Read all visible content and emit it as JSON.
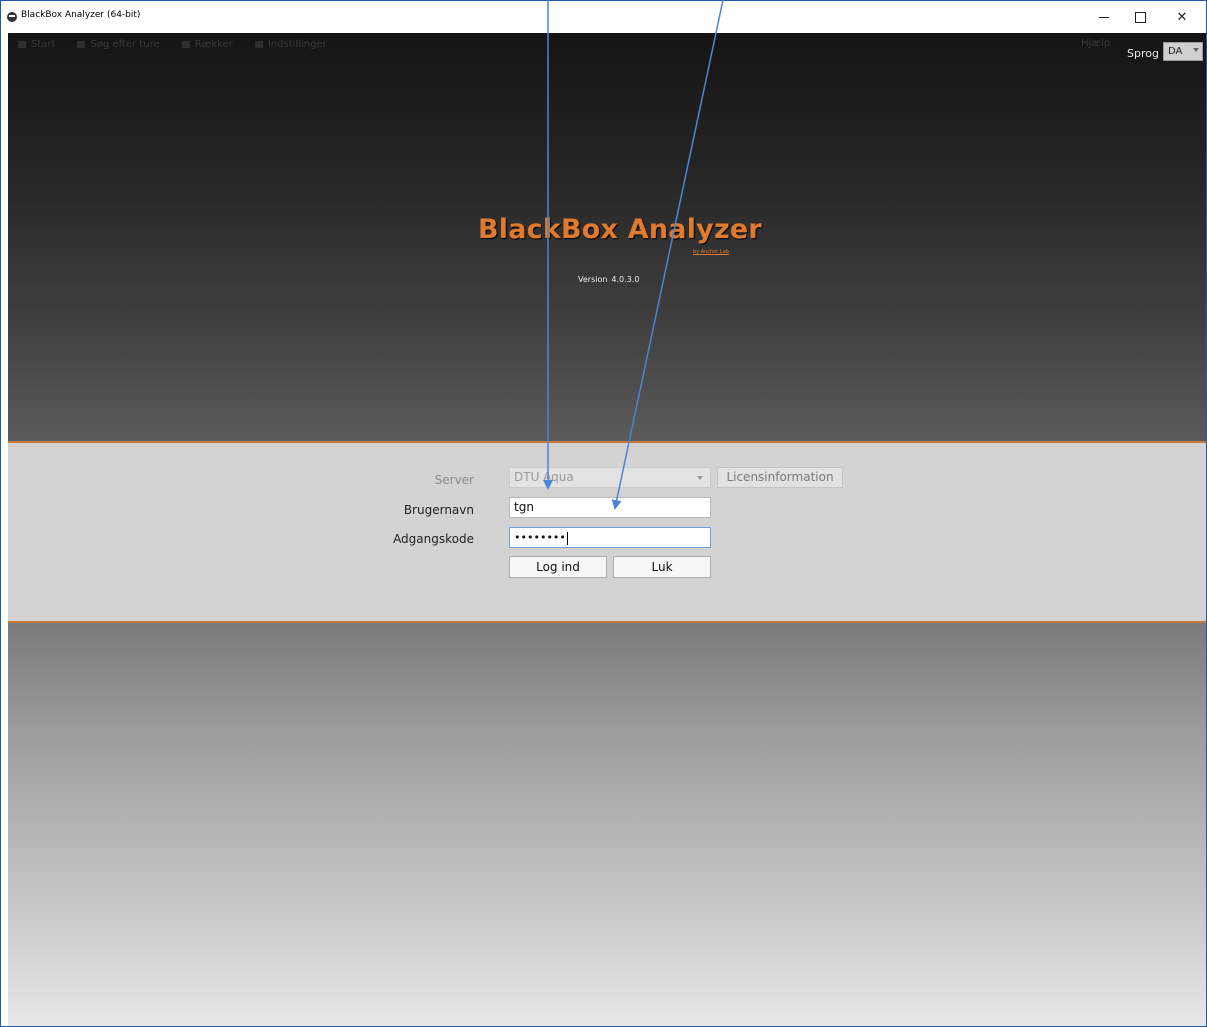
{
  "window": {
    "title": "BlackBox Analyzer (64-bit)",
    "controls": {
      "minimize": "–",
      "maximize": "□",
      "close": "✕"
    }
  },
  "topnav": {
    "items": [
      "Start",
      "Søg efter ture",
      "Rækker",
      "Indstillinger"
    ],
    "center": "",
    "help": "Hjælp"
  },
  "language": {
    "label": "Sprog",
    "value": "DA"
  },
  "branding": {
    "logo": "BlackBox Analyzer",
    "sub": "by Anchor Lab",
    "version_label": "Version",
    "version": "4.0.3.0",
    "accent_color": "#e07a2e"
  },
  "login": {
    "server_label": "Server",
    "server_value": "DTU Aqua",
    "license_button": "Licensinformation",
    "username_label": "Brugernavn",
    "username_value": "tgn",
    "password_label": "Adgangskode",
    "password_value": "••••••••",
    "login_button": "Log ind",
    "close_button": "Luk"
  }
}
